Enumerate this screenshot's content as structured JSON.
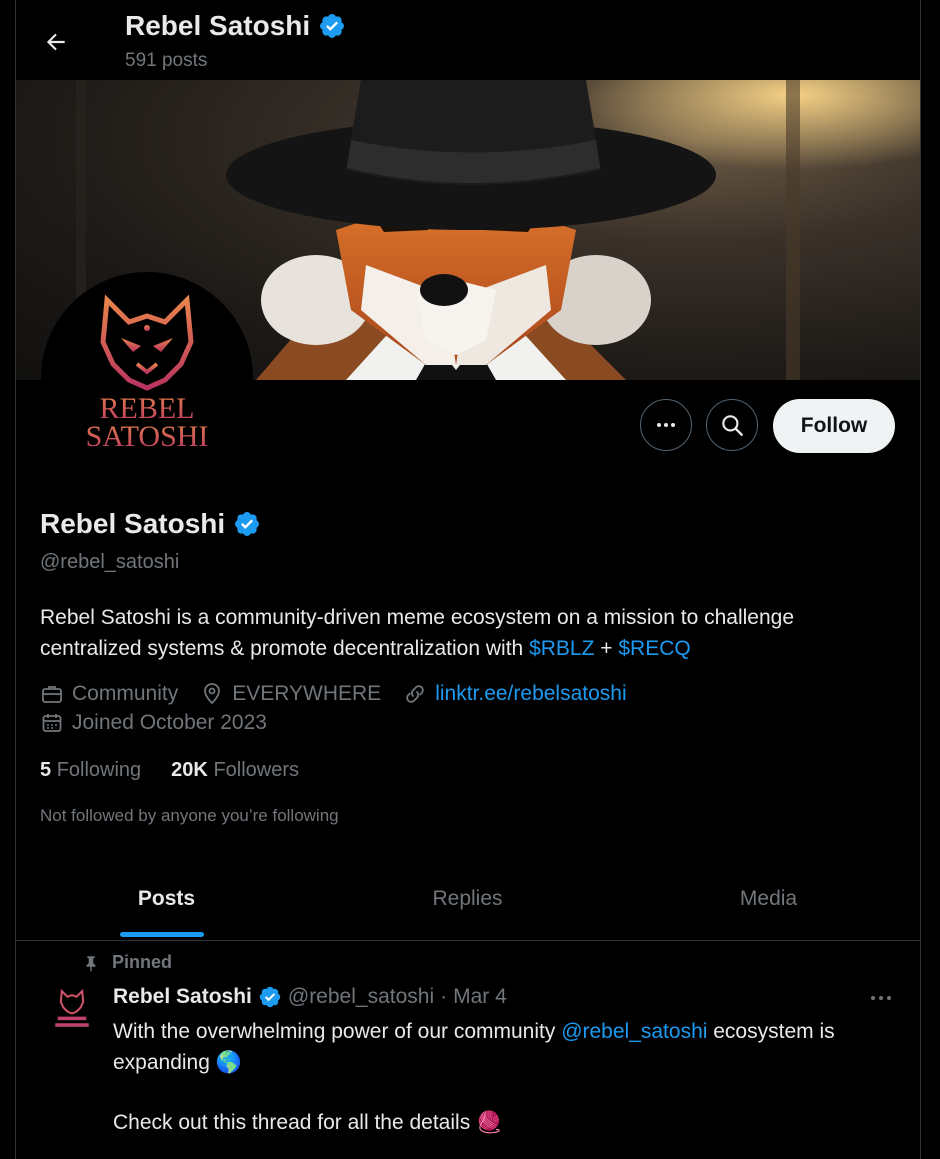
{
  "header": {
    "name": "Rebel Satoshi",
    "posts_count": "591 posts"
  },
  "profile": {
    "avatar_text_line1": "REBEL",
    "avatar_text_line2": "SATOSHI",
    "name": "Rebel Satoshi",
    "handle": "@rebel_satoshi",
    "bio_text": "Rebel Satoshi is a community-driven meme ecosystem on a mission to challenge centralized systems & promote decentralization with ",
    "bio_cashtag1": "$RBLZ",
    "bio_plus": " + ",
    "bio_cashtag2": "$RECQ",
    "category": "Community",
    "location": "EVERYWHERE",
    "website": "linktr.ee/rebelsatoshi",
    "joined": "Joined October 2023",
    "following_count": "5",
    "following_label": "Following",
    "followers_count": "20K",
    "followers_label": "Followers",
    "not_followed_text": "Not followed by anyone you’re following"
  },
  "actions": {
    "follow_label": "Follow"
  },
  "tabs": [
    {
      "label": "Posts",
      "active": true
    },
    {
      "label": "Replies",
      "active": false
    },
    {
      "label": "Media",
      "active": false
    }
  ],
  "pinned_tweet": {
    "pinned_label": "Pinned",
    "author_name": "Rebel Satoshi",
    "author_handle": "@rebel_satoshi",
    "separator": "·",
    "date": "Mar 4",
    "text_part1": "With the overwhelming power of our community ",
    "mention": "@rebel_satoshi",
    "text_part2": " ecosystem is expanding 🌎",
    "text_line2": "Check out this thread for all the details 🧶"
  },
  "colors": {
    "accent": "#1d9bf0",
    "background": "#000000",
    "text_primary": "#e7e9ea",
    "text_secondary": "#71767b",
    "avatar_logo": "#c0416a"
  }
}
